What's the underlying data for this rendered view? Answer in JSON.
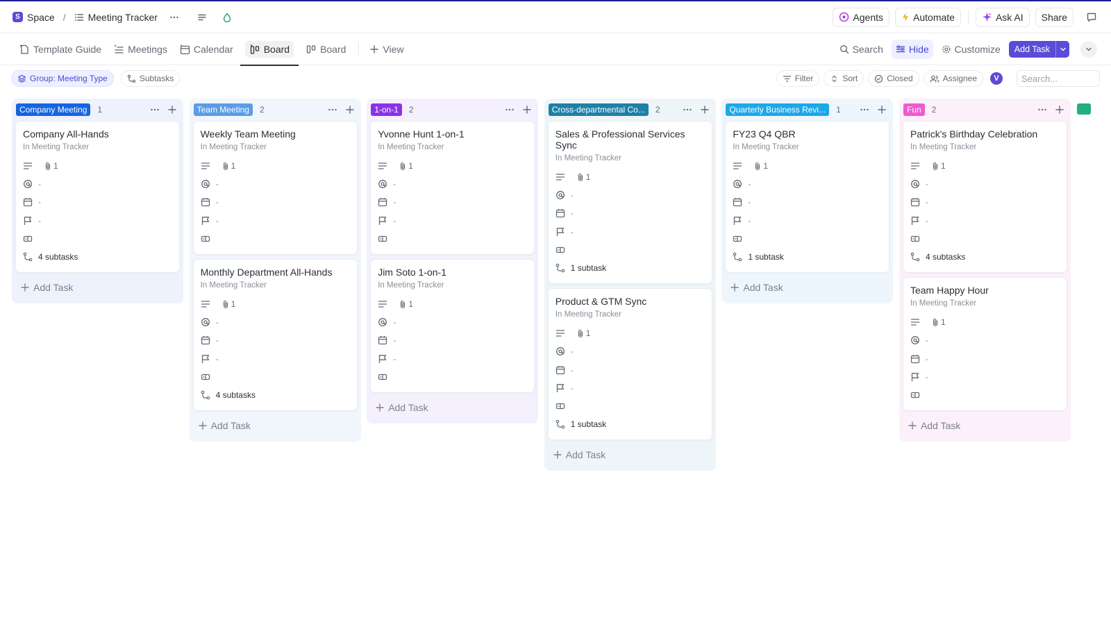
{
  "breadcrumb": {
    "space_initial": "S",
    "space": "Space",
    "separator": "/",
    "list": "Meeting Tracker"
  },
  "topbar": {
    "agents": "Agents",
    "automate": "Automate",
    "ask_ai": "Ask AI",
    "share": "Share"
  },
  "views": {
    "tabs": [
      {
        "label": "Template Guide",
        "icon": "doc-sparkle-icon"
      },
      {
        "label": "Meetings",
        "icon": "list-sparkle-icon"
      },
      {
        "label": "Calendar",
        "icon": "calendar-icon"
      },
      {
        "label": "Board",
        "icon": "board-icon",
        "active": true
      },
      {
        "label": "Board",
        "icon": "board-icon"
      }
    ],
    "add_view": "View",
    "search": "Search",
    "hide": "Hide",
    "customize": "Customize",
    "add_task": "Add Task"
  },
  "filters": {
    "group": "Group: Meeting Type",
    "subtasks": "Subtasks",
    "filter": "Filter",
    "sort": "Sort",
    "closed": "Closed",
    "assignee": "Assignee",
    "avatar_initial": "V",
    "search_placeholder": "Search..."
  },
  "board": {
    "add_task_label": "Add Task",
    "empty_value": "-",
    "columns": [
      {
        "label": "Company Meeting",
        "count": "1",
        "color": "#1565e0",
        "bg": "#eef2fc",
        "cards": [
          {
            "title": "Company All-Hands",
            "location": "In Meeting Tracker",
            "attachments": "1",
            "subtasks": "4 subtasks"
          }
        ]
      },
      {
        "label": "Team Meeting",
        "count": "2",
        "color": "#5a9ce6",
        "bg": "#f1f5fc",
        "cards": [
          {
            "title": "Weekly Team Meeting",
            "location": "In Meeting Tracker",
            "attachments": "1",
            "subtasks": ""
          },
          {
            "title": "Monthly Department All-Hands",
            "location": "In Meeting Tracker",
            "attachments": "1",
            "subtasks": "4 subtasks"
          }
        ]
      },
      {
        "label": "1-on-1",
        "count": "2",
        "color": "#8a32e8",
        "bg": "#f5f0fd",
        "cards": [
          {
            "title": "Yvonne Hunt 1-on-1",
            "location": "In Meeting Tracker",
            "attachments": "1",
            "subtasks": ""
          },
          {
            "title": "Jim Soto 1-on-1",
            "location": "In Meeting Tracker",
            "attachments": "1",
            "subtasks": ""
          }
        ]
      },
      {
        "label": "Cross-departmental Co...",
        "count": "2",
        "color": "#1f7fa8",
        "bg": "#eef5f8",
        "cards": [
          {
            "title": "Sales & Professional Services Sync",
            "location": "In Meeting Tracker",
            "attachments": "1",
            "subtasks": "1 subtask"
          },
          {
            "title": "Product & GTM Sync",
            "location": "In Meeting Tracker",
            "attachments": "1",
            "subtasks": "1 subtask"
          }
        ]
      },
      {
        "label": "Quarterly Business Revi...",
        "count": "1",
        "color": "#1ea7e8",
        "bg": "#edf6fc",
        "cards": [
          {
            "title": "FY23 Q4 QBR",
            "location": "In Meeting Tracker",
            "attachments": "1",
            "subtasks": "1 subtask"
          }
        ]
      },
      {
        "label": "Fun",
        "count": "2",
        "color": "#ee5bd0",
        "bg": "#fcf0fa",
        "cards": [
          {
            "title": "Patrick's Birthday Celebration",
            "location": "In Meeting Tracker",
            "attachments": "1",
            "subtasks": "4 subtasks"
          },
          {
            "title": "Team Happy Hour",
            "location": "In Meeting Tracker",
            "attachments": "1",
            "subtasks": ""
          }
        ]
      }
    ],
    "partial_column_color": "#22b07d"
  }
}
